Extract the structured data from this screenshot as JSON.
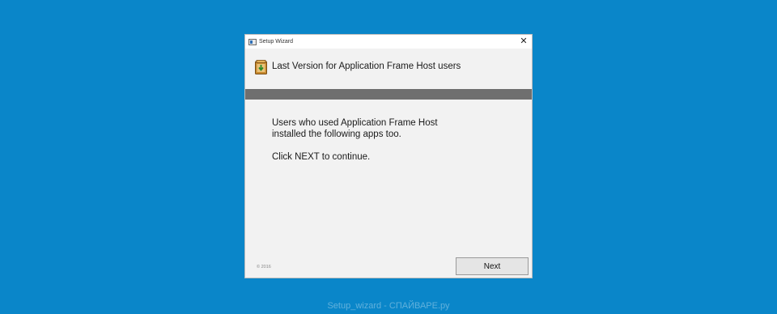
{
  "window": {
    "title": "Setup Wizard",
    "close_glyph": "✕"
  },
  "header": {
    "title": "Last Version for Application Frame Host users",
    "icon": "installer-package-icon"
  },
  "body": {
    "line1": "Users who used Application Frame Host",
    "line2": "installed the following apps too.",
    "line3": "Click NEXT to continue."
  },
  "footer": {
    "copyright": "© 2016",
    "next_label": "Next"
  },
  "watermark": "Setup_wizard - СПАЙВАРЕ.ру",
  "colors": {
    "desktop": "#0a86c9",
    "grey_bar": "#6f6f6f",
    "window_bg": "#f2f2f2"
  }
}
